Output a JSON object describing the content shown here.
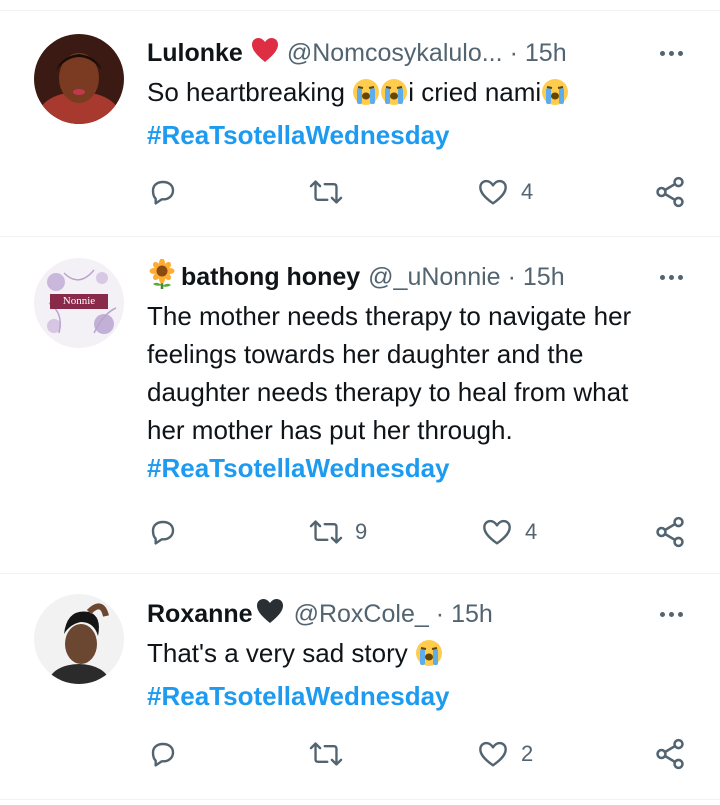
{
  "colors": {
    "link": "#1d9bf0",
    "text": "#0f1419",
    "muted": "#536471",
    "heart": "#e0245e"
  },
  "tweets": [
    {
      "name": "Lulonke",
      "name_emoji": "heart-icon",
      "handle": "@Nomcosykalulo...",
      "separator": "·",
      "time": "15h",
      "text": "So heartbreaking",
      "text_mid": "i cried nami",
      "hashtag": "#ReaTsotellaWednesday",
      "replies": "",
      "retweets": "",
      "likes": "4"
    },
    {
      "name": "bathong honey",
      "name_emoji": "sunflower-icon",
      "handle": "@_uNonnie",
      "separator": "·",
      "time": "15h",
      "avatar_text": "Nonnie",
      "lines": [
        "The mother needs therapy to navigate her",
        "feelings towards her daughter and the",
        "daughter needs therapy to heal from what",
        "her mother has put her through."
      ],
      "hashtag": "#ReaTsotellaWednesday",
      "replies": "",
      "retweets": "9",
      "likes": "4"
    },
    {
      "name": "Roxanne",
      "name_emoji": "black-heart-icon",
      "handle": "@RoxCole_",
      "separator": "·",
      "time": "15h",
      "text": "That's a very sad story",
      "hashtag": "#ReaTsotellaWednesday",
      "replies": "",
      "retweets": "",
      "likes": "2"
    }
  ]
}
